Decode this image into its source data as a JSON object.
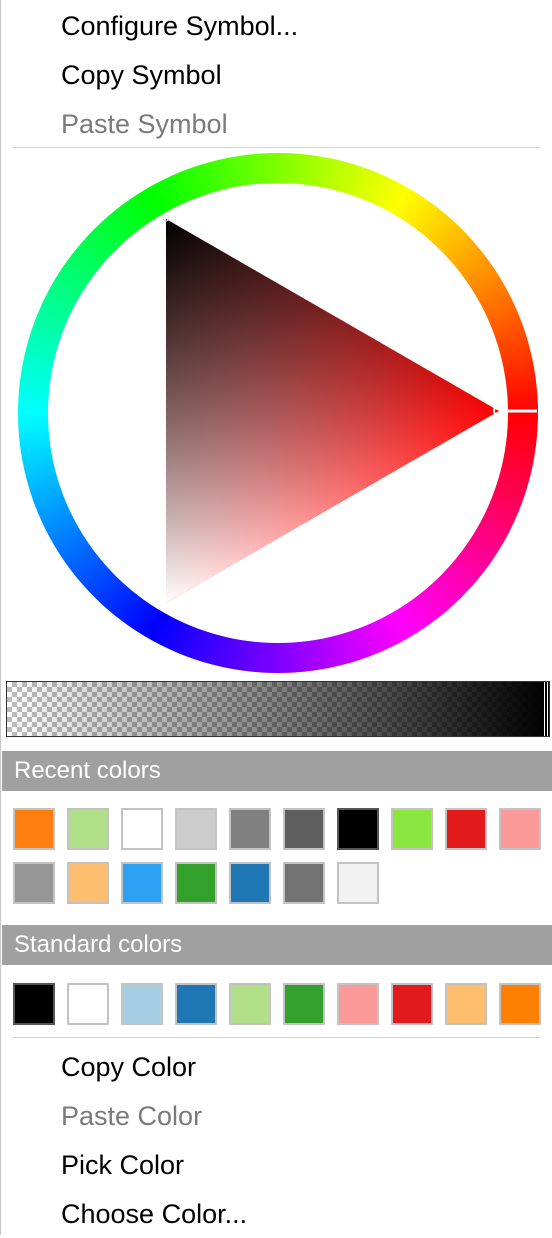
{
  "menu": {
    "configure_symbol": "Configure Symbol...",
    "copy_symbol": "Copy Symbol",
    "paste_symbol": "Paste Symbol",
    "copy_color": "Copy Color",
    "paste_color": "Paste Color",
    "pick_color": "Pick Color",
    "choose_color": "Choose Color..."
  },
  "color_picker": {
    "current_hue_degrees": 0,
    "current_color": "#ff0000",
    "opacity": 1.0
  },
  "recent": {
    "label": "Recent colors",
    "colors": [
      "#ff7f0e",
      "#b2df8a",
      "#ffffff",
      "#cccccc",
      "#808080",
      "#5e5e5e",
      "#000000",
      "#8ce641",
      "#e31a1c",
      "#fb9a99",
      "#969696",
      "#fdbf6f",
      "#2ea1f5",
      "#33a02c",
      "#1f78b4",
      "#737373",
      "#f2f2f2"
    ]
  },
  "standard": {
    "label": "Standard colors",
    "colors": [
      "#000000",
      "#ffffff",
      "#a6cee3",
      "#1f78b4",
      "#b2df8a",
      "#33a02c",
      "#fb9a99",
      "#e31a1c",
      "#fdbf6f",
      "#ff7f00"
    ]
  }
}
